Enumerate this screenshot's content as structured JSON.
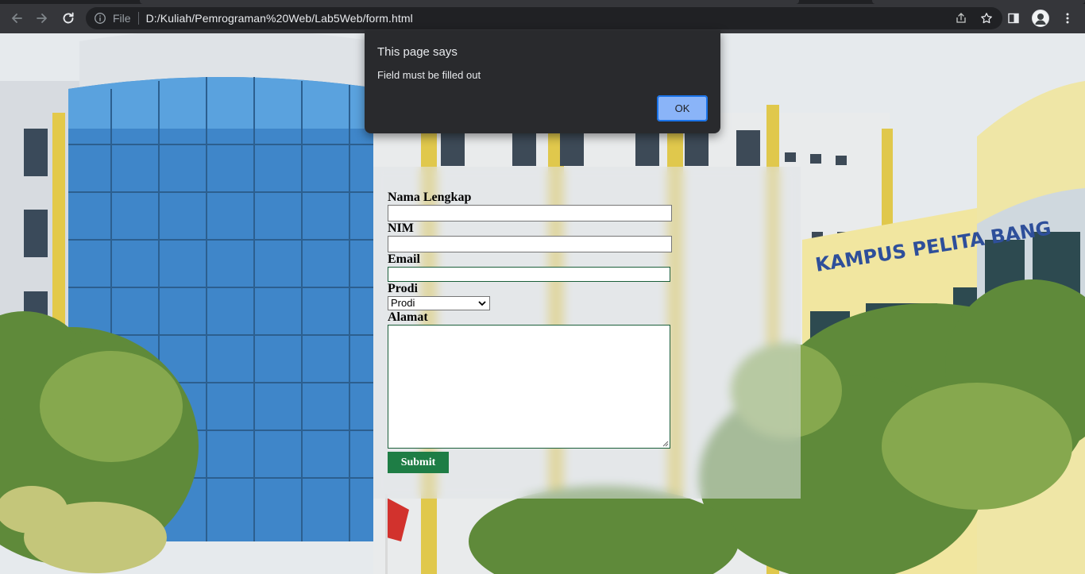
{
  "browser": {
    "url_scheme_label": "File",
    "url": "D:/Kuliah/Pemrograman%20Web/Lab5Web/form.html",
    "icons": {
      "back": "arrow-left-icon",
      "forward": "arrow-right-icon",
      "reload": "reload-icon",
      "site_info": "info-icon",
      "share": "share-icon",
      "bookmark": "star-icon",
      "side_panel": "side-panel-icon",
      "profile": "profile-avatar",
      "menu": "kebab-menu-icon"
    }
  },
  "dialog": {
    "title": "This page says",
    "message": "Field must be filled out",
    "ok_label": "OK"
  },
  "background": {
    "sign_text": "KAMPUS PELITA BANG"
  },
  "form": {
    "fields": {
      "nama_label": "Nama Lengkap",
      "nim_label": "NIM",
      "email_label": "Email",
      "prodi_label": "Prodi",
      "prodi_selected": "Prodi",
      "alamat_label": "Alamat"
    },
    "submit_label": "Submit"
  },
  "colors": {
    "chrome_bg": "#35363a",
    "omnibox_bg": "#202124",
    "dialog_bg": "#292a2d",
    "dialog_button": "#8ab4f8",
    "submit_bg": "#1e7d45"
  }
}
